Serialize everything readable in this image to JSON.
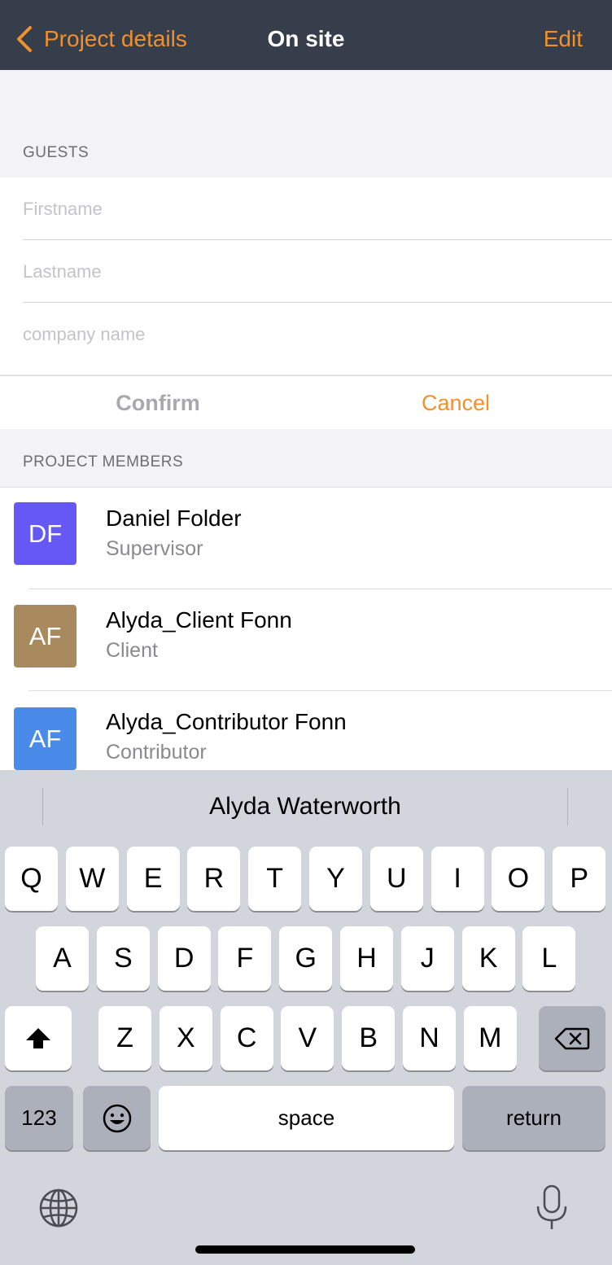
{
  "navbar": {
    "back_label": "Project details",
    "title": "On site",
    "edit_label": "Edit",
    "accent_color": "#f0902f"
  },
  "guests": {
    "header": "GUESTS",
    "firstname_placeholder": "Firstname",
    "lastname_placeholder": "Lastname",
    "company_placeholder": "company name",
    "confirm_label": "Confirm",
    "cancel_label": "Cancel"
  },
  "members": {
    "header": "PROJECT MEMBERS",
    "items": [
      {
        "initials": "DF",
        "name": "Daniel Folder",
        "role": "Supervisor",
        "color": "#6558f5"
      },
      {
        "initials": "AF",
        "name": "Alyda_Client Fonn",
        "role": "Client",
        "color": "#a88a5e"
      },
      {
        "initials": "AF",
        "name": "Alyda_Contributor Fonn",
        "role": "Contributor",
        "color": "#4a8be9"
      }
    ]
  },
  "keyboard": {
    "suggestion": "Alyda Waterworth",
    "row1": [
      "Q",
      "W",
      "E",
      "R",
      "T",
      "Y",
      "U",
      "I",
      "O",
      "P"
    ],
    "row2": [
      "A",
      "S",
      "D",
      "F",
      "G",
      "H",
      "J",
      "K",
      "L"
    ],
    "row3": [
      "Z",
      "X",
      "C",
      "V",
      "B",
      "N",
      "M"
    ],
    "numbers_label": "123",
    "space_label": "space",
    "return_label": "return",
    "shift_icon": "shift-icon",
    "backspace_icon": "backspace-icon",
    "emoji_icon": "emoji-icon",
    "globe_icon": "globe-icon",
    "mic_icon": "microphone-icon"
  }
}
